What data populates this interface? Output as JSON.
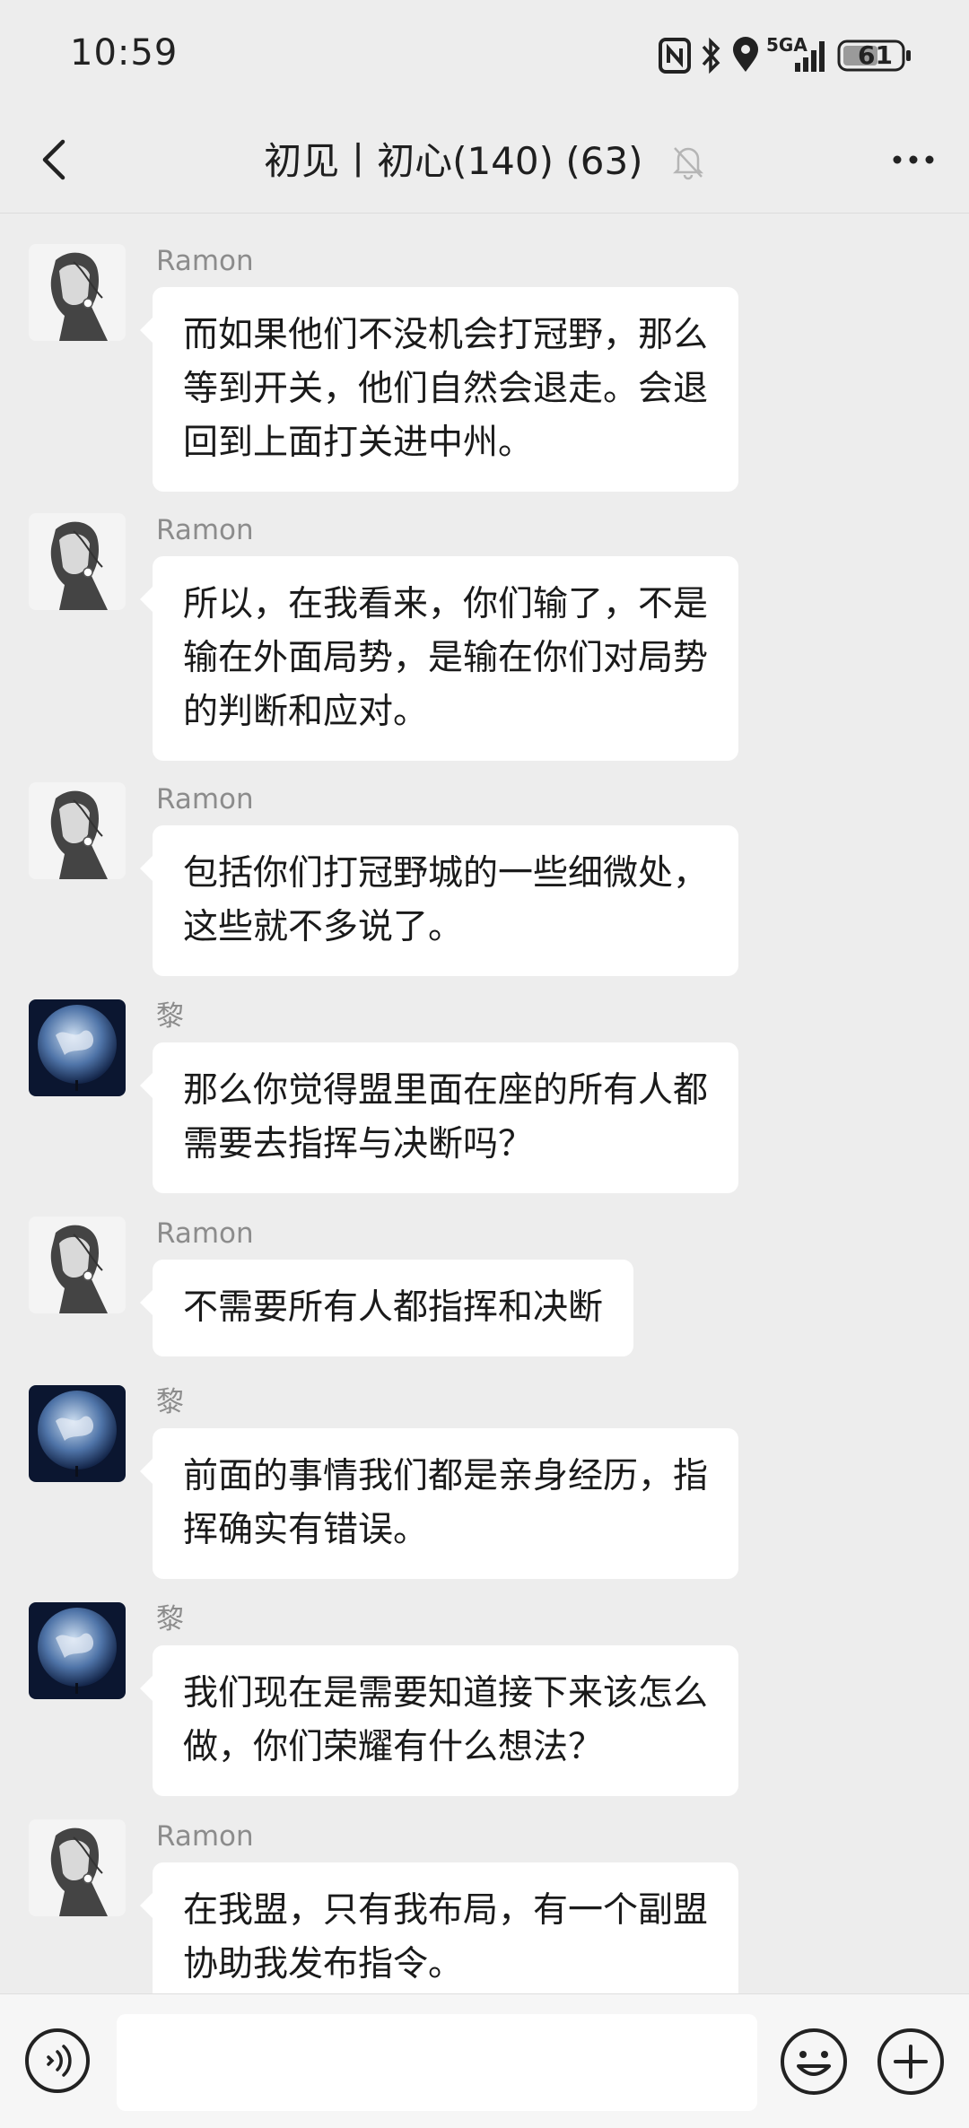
{
  "status_bar": {
    "time": "10:59",
    "network": "5GA",
    "battery": "61"
  },
  "header": {
    "title": "初见丨初心(140) (63)",
    "icons": [
      "back-arrow-icon",
      "mute-bell-icon",
      "more-icon"
    ]
  },
  "messages": [
    {
      "sender": "Ramon",
      "avatar": "ramon-avatar",
      "text": "而如果他们不没机会打冠野，那么\n等到开关，他们自然会退走。会退\n回到上面打关进中州。"
    },
    {
      "sender": "Ramon",
      "avatar": "ramon-avatar",
      "text": "所以，在我看来，你们输了，不是\n输在外面局势，是输在你们对局势\n的判断和应对。"
    },
    {
      "sender": "Ramon",
      "avatar": "ramon-avatar",
      "text": "包括你们打冠野城的一些细微处，\n这些就不多说了。"
    },
    {
      "sender": "黎",
      "avatar": "earth-avatar",
      "text": "那么你觉得盟里面在座的所有人都\n需要去指挥与决断吗？"
    },
    {
      "sender": "Ramon",
      "avatar": "ramon-avatar",
      "text": "不需要所有人都指挥和决断"
    },
    {
      "sender": "黎",
      "avatar": "earth-avatar",
      "text": "前面的事情我们都是亲身经历，指\n挥确实有错误。"
    },
    {
      "sender": "黎",
      "avatar": "earth-avatar",
      "text": "我们现在是需要知道接下来该怎么\n做，你们荣耀有什么想法？"
    },
    {
      "sender": "Ramon",
      "avatar": "ramon-avatar",
      "text": "在我盟，只有我布局，有一个副盟\n协助我发布指令。"
    }
  ],
  "input_bar": {
    "placeholder": "",
    "icons": [
      "voice-icon",
      "emoji-icon",
      "plus-icon"
    ]
  },
  "colors": {
    "background": "#ededed",
    "bubble": "#ffffff",
    "text": "#1a1a1a",
    "sender": "#8c8c8c"
  }
}
